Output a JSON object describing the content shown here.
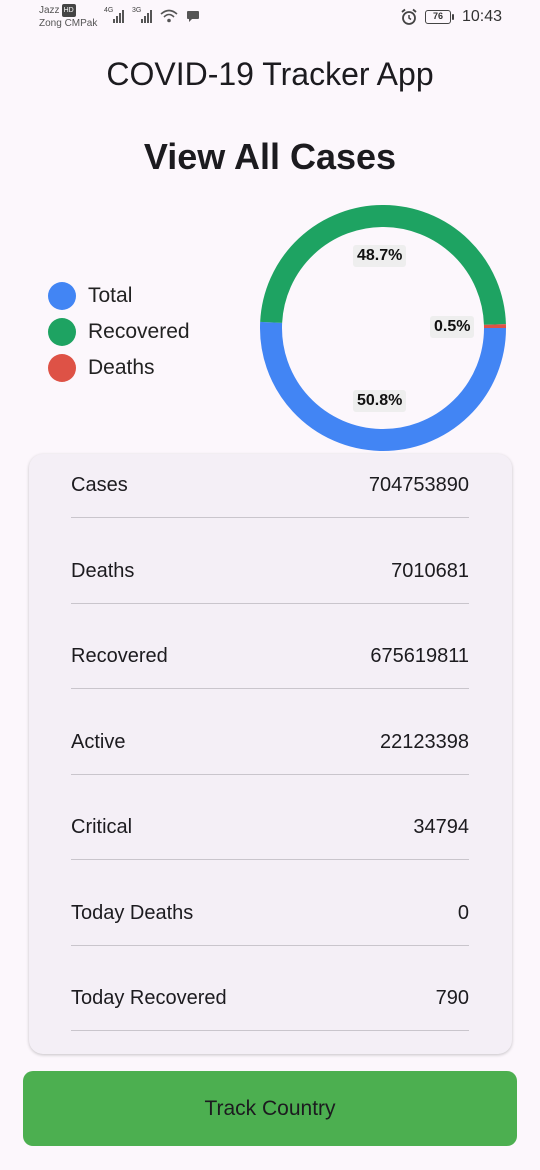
{
  "status_bar": {
    "carrier_line1": "Jazz",
    "carrier_hd": "HD",
    "carrier_line2": "Zong CMPak",
    "network1": "4G",
    "network2": "3G",
    "battery": "76",
    "time": "10:43",
    "icons": [
      "signal-icon",
      "wifi-icon",
      "chat-icon",
      "alarm-icon",
      "battery-icon"
    ]
  },
  "app": {
    "title": "COVID-19 Tracker App"
  },
  "heading": "View All Cases",
  "legend": [
    {
      "label": "Total",
      "color": "#4285f4"
    },
    {
      "label": "Recovered",
      "color": "#1ea362"
    },
    {
      "label": "Deaths",
      "color": "#de5246"
    }
  ],
  "chart_data": {
    "type": "pie",
    "categories": [
      "Total",
      "Recovered",
      "Deaths"
    ],
    "values": [
      50.8,
      48.7,
      0.5
    ],
    "labels": [
      "50.8%",
      "48.7%",
      "0.5%"
    ],
    "colors": [
      "#4285f4",
      "#1ea362",
      "#de5246"
    ],
    "style": "donut"
  },
  "stats": [
    {
      "label": "Cases",
      "value": "704753890"
    },
    {
      "label": "Deaths",
      "value": "7010681"
    },
    {
      "label": "Recovered",
      "value": "675619811"
    },
    {
      "label": "Active",
      "value": "22123398"
    },
    {
      "label": "Critical",
      "value": "34794"
    },
    {
      "label": "Today Deaths",
      "value": "0"
    },
    {
      "label": "Today Recovered",
      "value": "790"
    }
  ],
  "button": {
    "label": "Track Country",
    "color": "#4caf50"
  }
}
